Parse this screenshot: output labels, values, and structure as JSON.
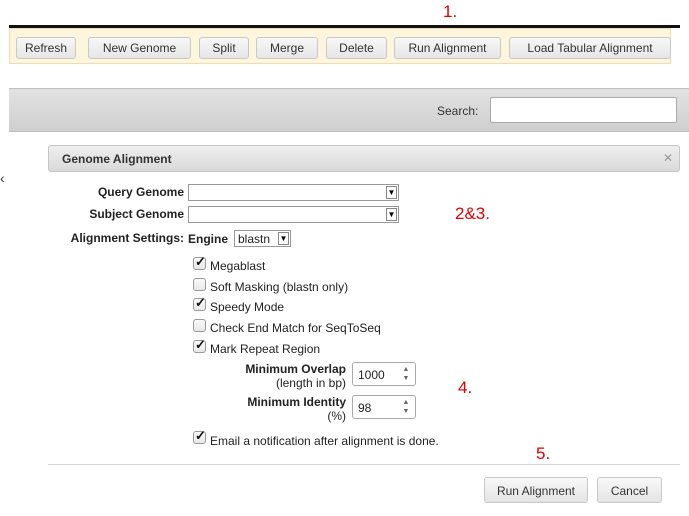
{
  "annotations": {
    "a1": "1.",
    "a23": "2&3.",
    "a4": "4.",
    "a5": "5."
  },
  "toolbar": {
    "buttons": [
      "Refresh",
      "New Genome",
      "Split",
      "Merge",
      "Delete",
      "Run Alignment",
      "Load Tabular Alignment"
    ]
  },
  "search": {
    "label": "Search:",
    "value": ""
  },
  "dialog": {
    "title": "Genome Alignment",
    "close_icon": "close-icon",
    "query_label": "Query Genome",
    "query_value": "",
    "subject_label": "Subject Genome",
    "subject_value": "",
    "settings_label": "Alignment Settings:",
    "engine_label": "Engine",
    "engine_value": "blastn",
    "options": [
      {
        "label": "Megablast",
        "checked": true
      },
      {
        "label": "Soft Masking (blastn only)",
        "checked": false
      },
      {
        "label": "Speedy Mode",
        "checked": true
      },
      {
        "label": "Check End Match for SeqToSeq",
        "checked": false
      },
      {
        "label": "Mark Repeat Region",
        "checked": true
      }
    ],
    "min_overlap_label": "Minimum Overlap",
    "min_overlap_sub": "(length in bp)",
    "min_overlap_value": "1000",
    "min_identity_label": "Minimum Identity",
    "min_identity_sub": "(%)",
    "min_identity_value": "98",
    "email_label": "Email a notification after alignment is done.",
    "email_checked": true,
    "run_button": "Run Alignment",
    "cancel_button": "Cancel"
  }
}
